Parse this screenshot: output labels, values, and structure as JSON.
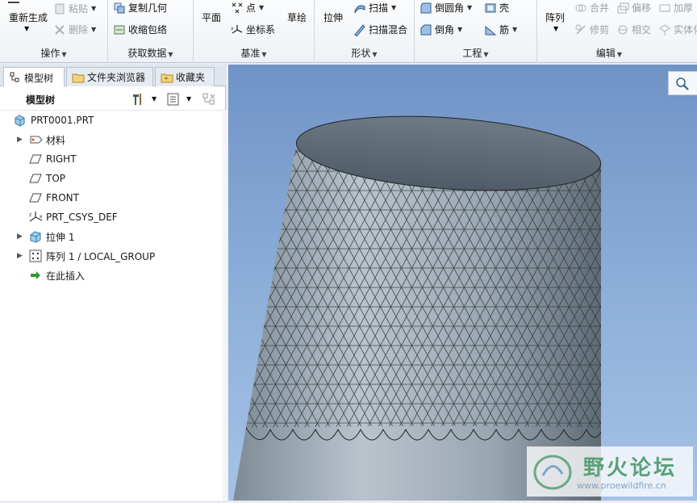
{
  "ribbon": {
    "groups": {
      "operations": {
        "label": "操作",
        "regenerate": "重新生成",
        "paste": "粘贴",
        "delete": "删除"
      },
      "get_data": {
        "label": "获取数据",
        "copy_geometry": "复制几何",
        "shrinkwrap": "收缩包络"
      },
      "datum": {
        "label": "基准",
        "plane": "平面",
        "point": "点",
        "csys": "坐标系",
        "sketch": "草绘"
      },
      "shapes": {
        "label": "形状",
        "extrude": "拉伸",
        "sweep": "扫描",
        "swept_blend": "扫描混合"
      },
      "engineering": {
        "label": "工程",
        "round": "倒圆角",
        "chamfer": "倒角",
        "shell": "壳",
        "rib": "筋"
      },
      "editing": {
        "label": "编辑",
        "pattern": "阵列",
        "merge": "合并",
        "offset": "偏移",
        "thicken": "加厚",
        "trim": "修剪",
        "intersect": "相交",
        "solidify": "实体化"
      }
    }
  },
  "panel_tabs": {
    "model_tree": "模型树",
    "folder_browser": "文件夹浏览器",
    "favorites": "收藏夹"
  },
  "tree": {
    "title": "模型树",
    "items": [
      {
        "label": "PRT0001.PRT"
      },
      {
        "label": "材料"
      },
      {
        "label": "RIGHT"
      },
      {
        "label": "TOP"
      },
      {
        "label": "FRONT"
      },
      {
        "label": "PRT_CSYS_DEF"
      },
      {
        "label": "拉伸 1"
      },
      {
        "label": "阵列 1 / LOCAL_GROUP"
      },
      {
        "label": "在此插入"
      }
    ]
  },
  "watermark": {
    "title": "野火论坛",
    "url": "www.proewildfire.cn"
  }
}
